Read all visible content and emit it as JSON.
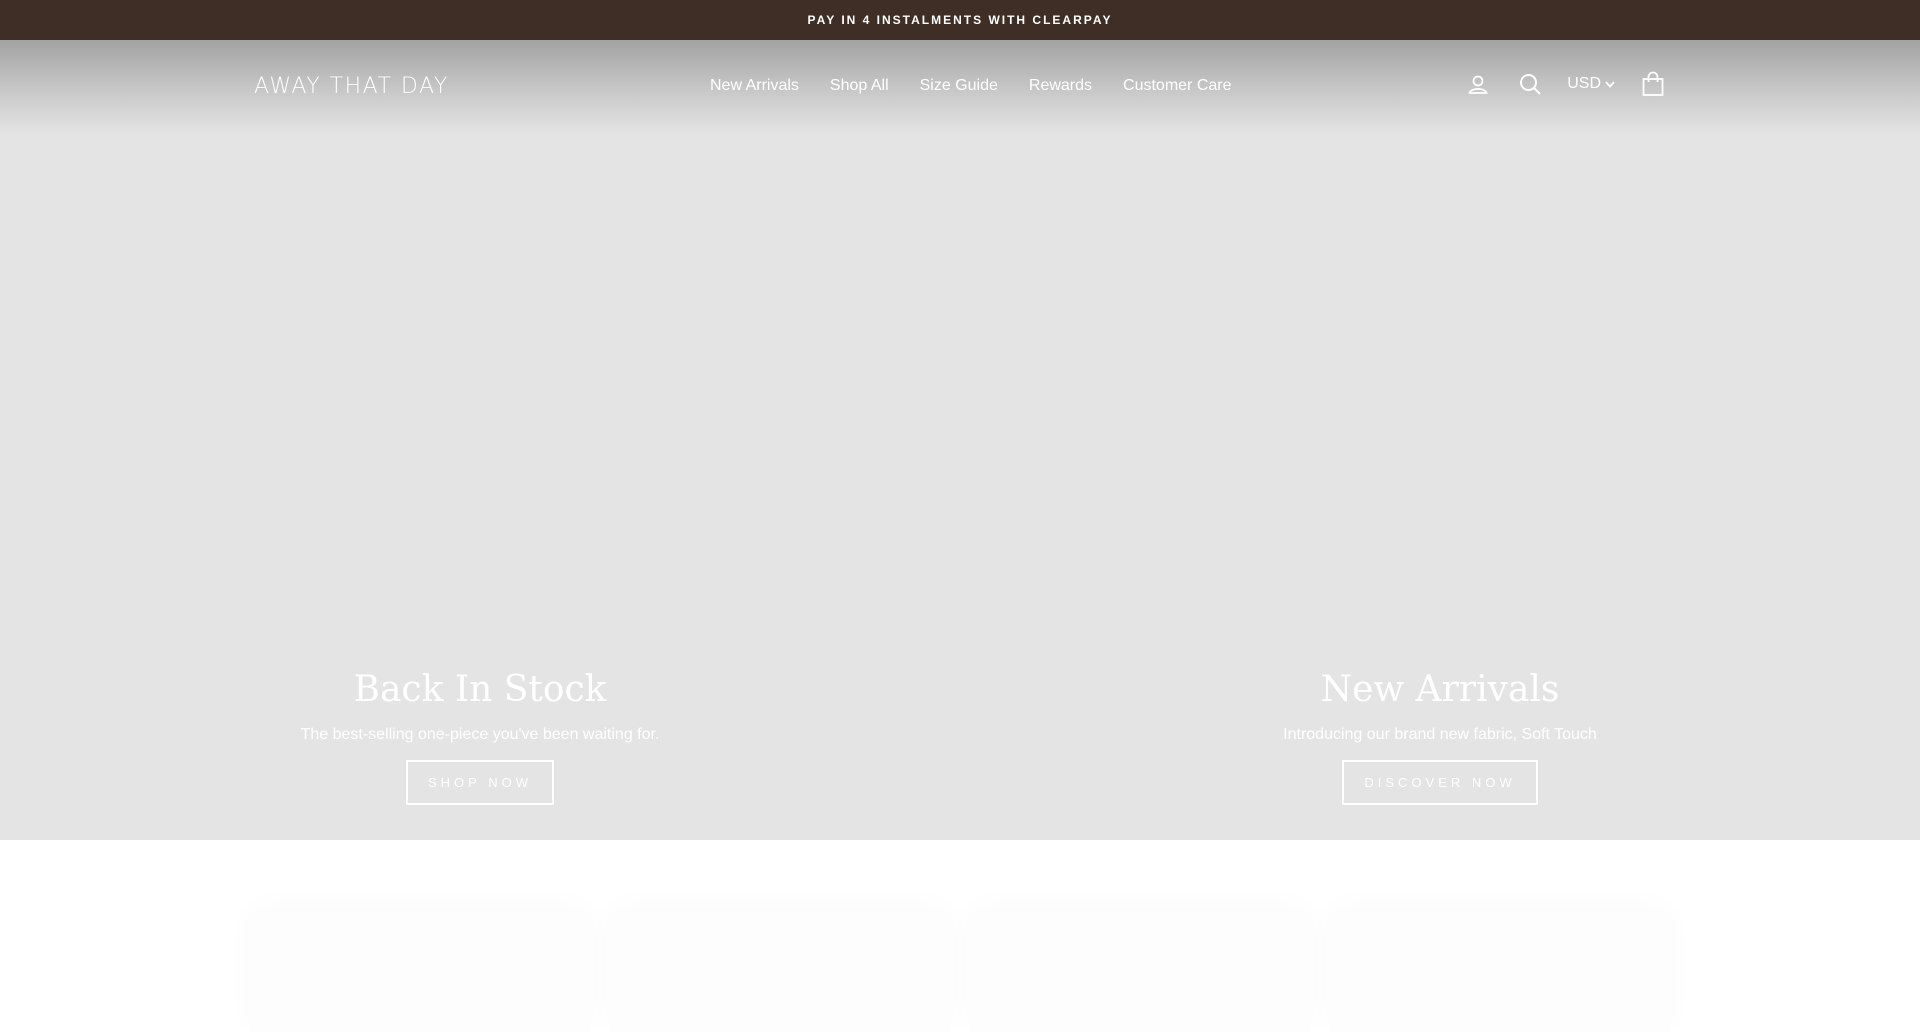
{
  "announcement": {
    "text": "PAY IN 4 INSTALMENTS WITH CLEARPAY"
  },
  "header": {
    "logo": "AWAY THAT DAY",
    "nav": [
      {
        "label": "New Arrivals"
      },
      {
        "label": "Shop All"
      },
      {
        "label": "Size Guide"
      },
      {
        "label": "Rewards"
      },
      {
        "label": "Customer Care"
      }
    ],
    "icons": {
      "account": "user-icon",
      "search": "search-icon",
      "cart": "bag-icon"
    },
    "currency": "USD"
  },
  "hero": {
    "left": {
      "title": "Back In Stock",
      "subtitle": "The best-selling one-piece you've been waiting for.",
      "button": "SHOP NOW"
    },
    "right": {
      "title": "New Arrivals",
      "subtitle": "Introducing our brand new fabric, Soft Touch",
      "button": "DISCOVER NOW"
    }
  },
  "colors": {
    "announcement_bg": "#3e2e25",
    "hero_bg": "#e4e4e4",
    "text_light": "#ffffff"
  }
}
